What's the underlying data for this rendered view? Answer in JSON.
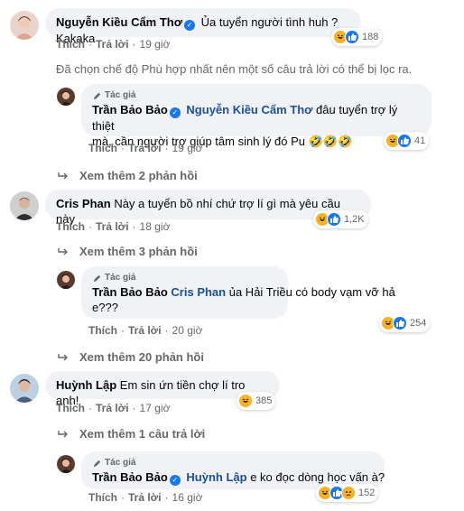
{
  "author_tag": "Tác giả",
  "actions": {
    "like": "Thích",
    "reply": "Trả lời"
  },
  "filter_note": "Đã chọn chế độ Phù hợp nhất nên một số câu trả lời có thể bị lọc ra.",
  "comments": [
    {
      "name": "Nguyễn Kiều Cẩm Thơ",
      "text": "Ủa tuyển người tình huh ? Kakaka",
      "time": "19 giờ",
      "reaction_count": "188"
    },
    {
      "name": "Trần Bảo Bảo",
      "mention": "Nguyễn Kiều Cẩm Thơ",
      "text_line1": "đâu tuyển trợ lý thiệt",
      "text_line2": "mà, cần người trợ giúp tâm sinh lý đó Pu 🤣🤣🤣",
      "time": "19 giờ",
      "reaction_count": "41",
      "more": "Xem thêm 2 phản hồi"
    },
    {
      "name": "Cris Phan",
      "text": "Này a tuyển bồ nhí chứ trợ lí gì mà yêu cầu này",
      "time": "18 giờ",
      "reaction_count": "1,2K",
      "more": "Xem thêm 3 phản hồi"
    },
    {
      "name": "Trần Bảo Bảo",
      "mention": "Cris Phan",
      "text_line1": "ủa Hải Triều có body vạm vỡ hả",
      "text_line2": "e???",
      "time": "20 giờ",
      "reaction_count": "254",
      "more": "Xem thêm 20 phản hồi"
    },
    {
      "name": "Huỳnh Lập",
      "text": "Em sin ứn tiền chợ lí tro anh!",
      "time": "17 giờ",
      "reaction_count": "385",
      "more": "Xem thêm 1 câu trả lời"
    },
    {
      "name": "Trần Bảo Bảo",
      "mention": "Huỳnh Lập",
      "text": "e ko đọc dòng học vấn à?",
      "time": "16 giờ",
      "reaction_count": "152"
    }
  ],
  "colors": {
    "like_blue": "#1877f2",
    "haha_yellow": "#f7b125",
    "bubble_bg": "#f0f2f5",
    "meta_gray": "#65676b"
  }
}
